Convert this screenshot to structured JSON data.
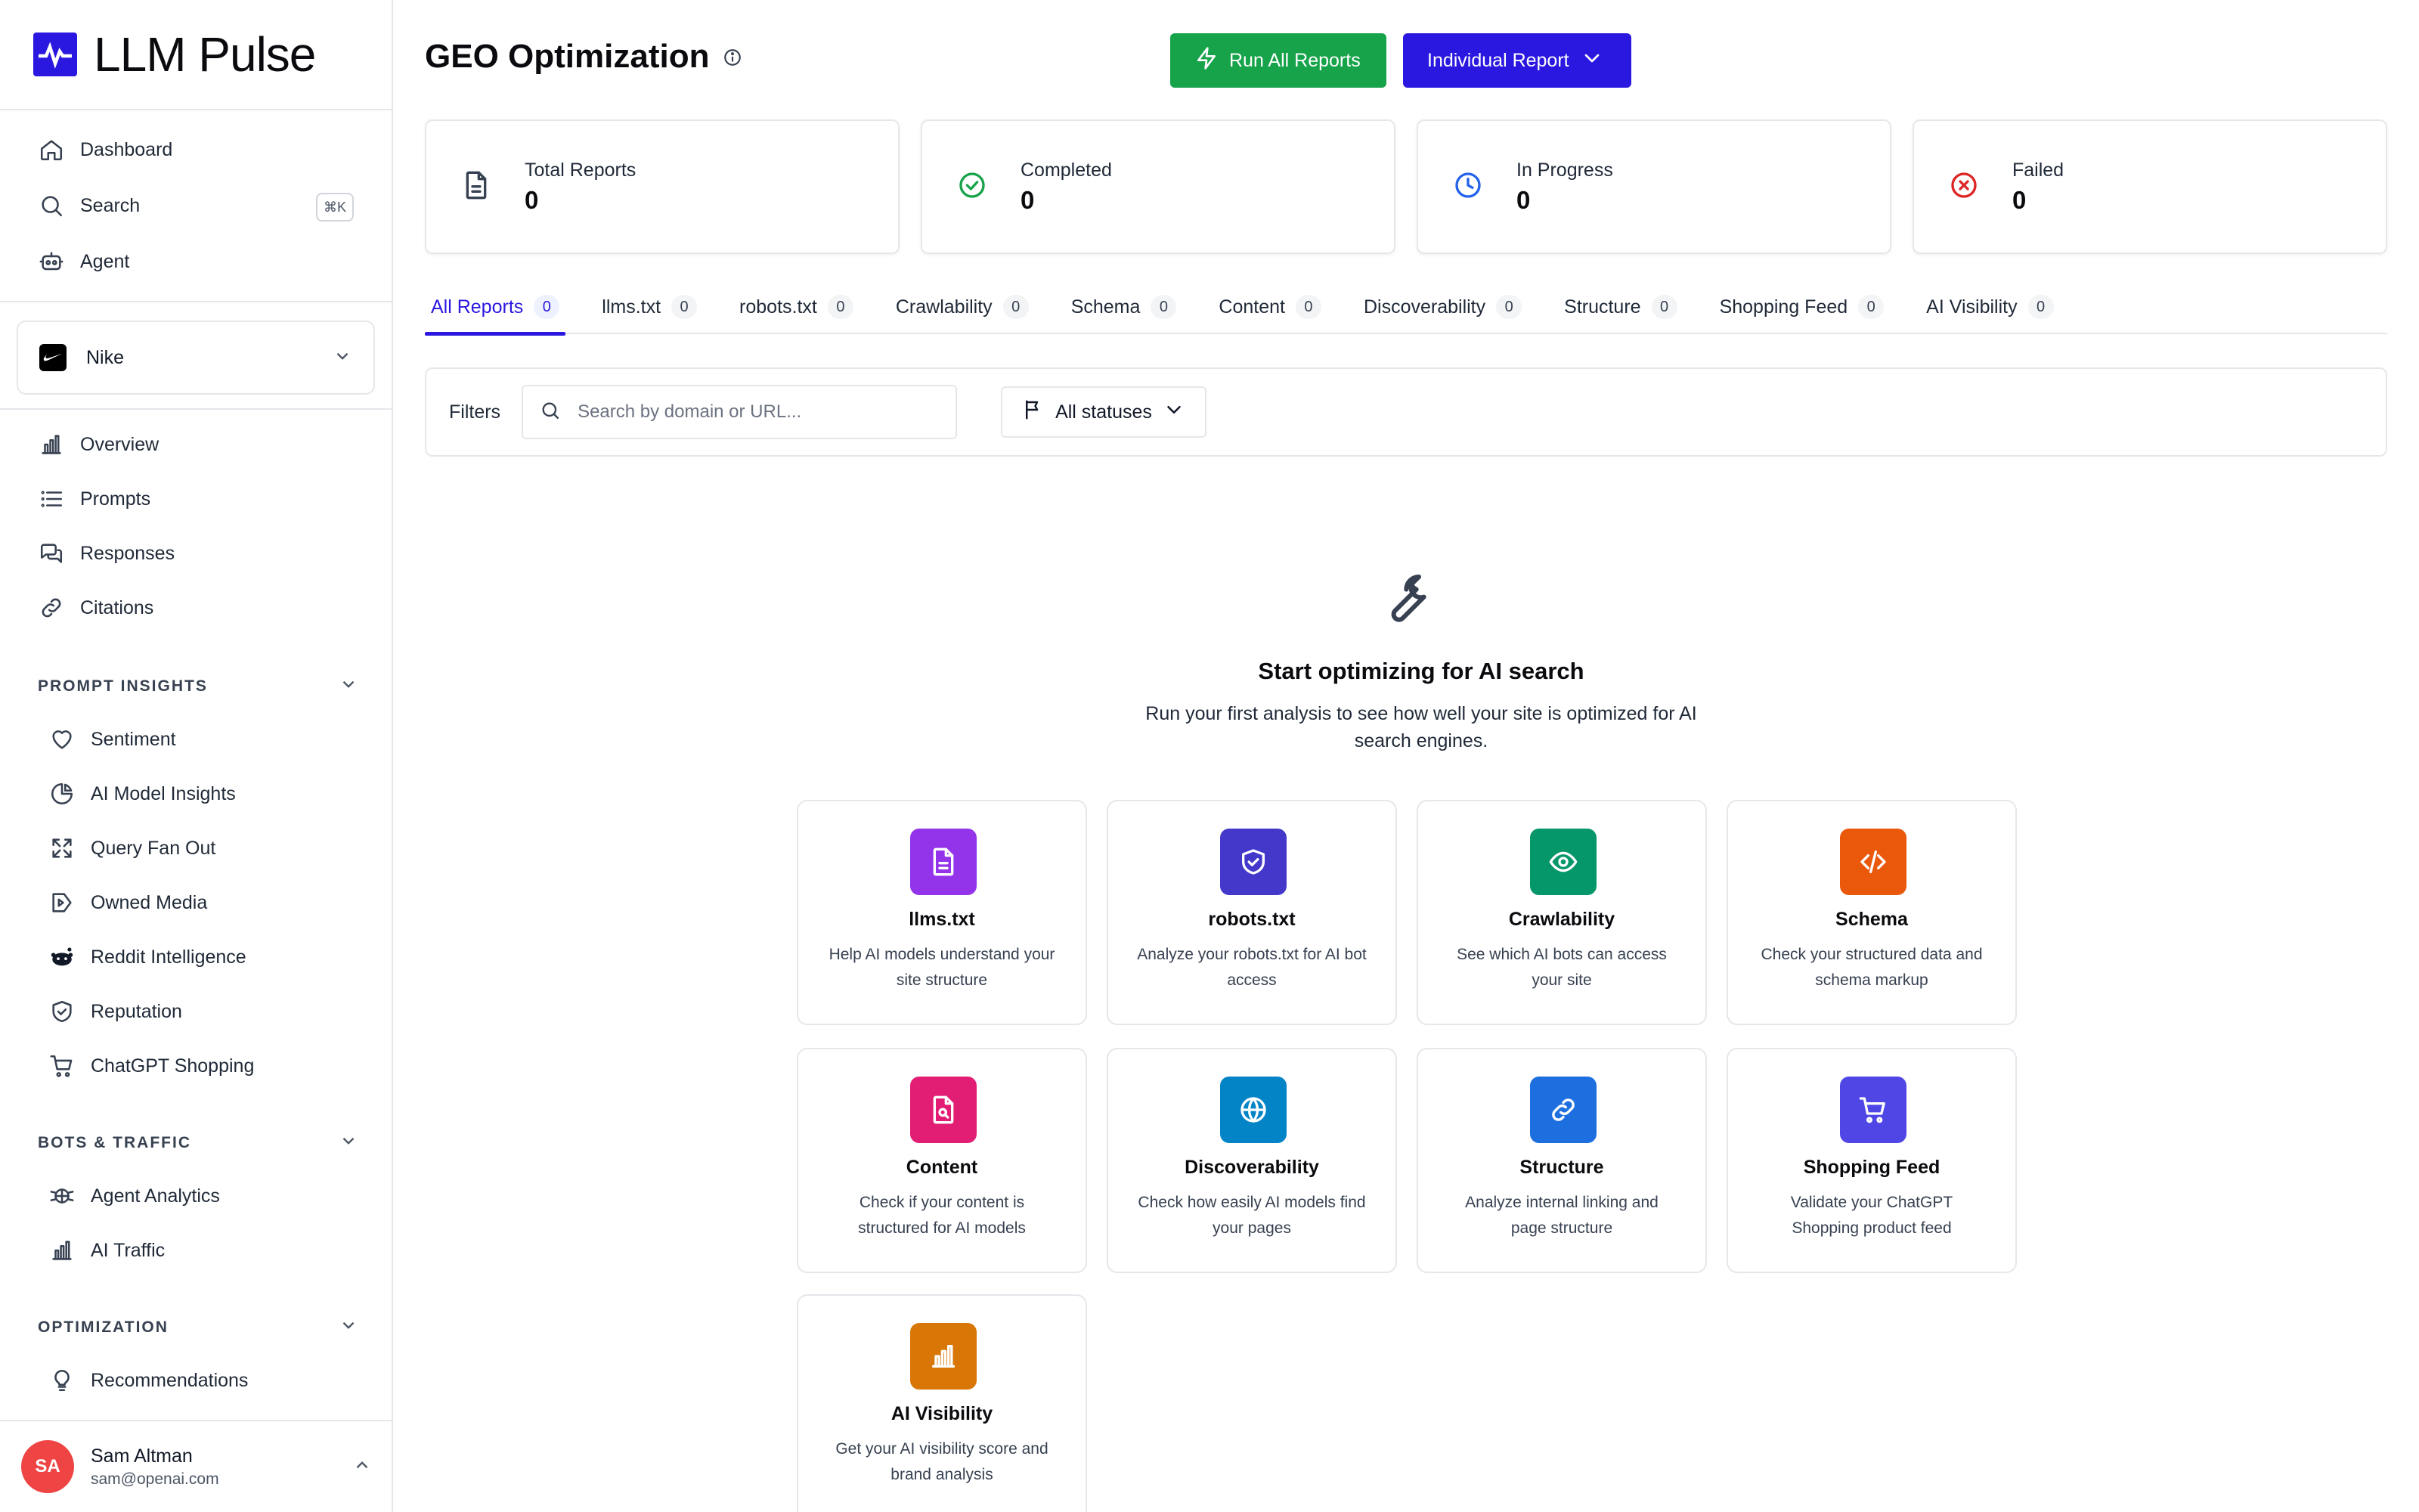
{
  "app": {
    "name": "LLM Pulse"
  },
  "nav": {
    "dashboard": "Dashboard",
    "search": "Search",
    "search_shortcut": "⌘K",
    "agent": "Agent"
  },
  "brand": {
    "name": "Nike"
  },
  "project_nav": {
    "overview": "Overview",
    "prompts": "Prompts",
    "responses": "Responses",
    "citations": "Citations"
  },
  "sections": {
    "prompt_insights": {
      "title": "PROMPT INSIGHTS",
      "items": [
        "Sentiment",
        "AI Model Insights",
        "Query Fan Out",
        "Owned Media",
        "Reddit Intelligence",
        "Reputation",
        "ChatGPT Shopping"
      ]
    },
    "bots_traffic": {
      "title": "BOTS & TRAFFIC",
      "items": [
        "Agent Analytics",
        "AI Traffic"
      ]
    },
    "optimization": {
      "title": "OPTIMIZATION",
      "items": [
        "Recommendations"
      ]
    }
  },
  "user": {
    "initials": "SA",
    "name": "Sam Altman",
    "email": "sam@openai.com"
  },
  "page": {
    "title": "GEO Optimization"
  },
  "actions": {
    "run_all": "Run All Reports",
    "individual": "Individual Report"
  },
  "stats": [
    {
      "label": "Total Reports",
      "value": "0",
      "color": "#374151"
    },
    {
      "label": "Completed",
      "value": "0",
      "color": "#16a34a"
    },
    {
      "label": "In Progress",
      "value": "0",
      "color": "#2563eb"
    },
    {
      "label": "Failed",
      "value": "0",
      "color": "#dc2626"
    }
  ],
  "tabs": [
    {
      "label": "All Reports",
      "count": "0"
    },
    {
      "label": "llms.txt",
      "count": "0"
    },
    {
      "label": "robots.txt",
      "count": "0"
    },
    {
      "label": "Crawlability",
      "count": "0"
    },
    {
      "label": "Schema",
      "count": "0"
    },
    {
      "label": "Content",
      "count": "0"
    },
    {
      "label": "Discoverability",
      "count": "0"
    },
    {
      "label": "Structure",
      "count": "0"
    },
    {
      "label": "Shopping Feed",
      "count": "0"
    },
    {
      "label": "AI Visibility",
      "count": "0"
    }
  ],
  "filters": {
    "label": "Filters",
    "search_placeholder": "Search by domain or URL...",
    "search_value": "",
    "status": "All statuses"
  },
  "empty_state": {
    "title": "Start optimizing for AI search",
    "subtitle": "Run your first analysis to see how well your site is optimized for AI search engines."
  },
  "report_types": [
    {
      "title": "llms.txt",
      "desc": "Help AI models understand your site structure",
      "color": "#9333ea",
      "icon": "file-text-icon"
    },
    {
      "title": "robots.txt",
      "desc": "Analyze your robots.txt for AI bot access",
      "color": "#4338ca",
      "icon": "shield-icon"
    },
    {
      "title": "Crawlability",
      "desc": "See which AI bots can access your site",
      "color": "#059669",
      "icon": "eye-icon"
    },
    {
      "title": "Schema",
      "desc": "Check your structured data and schema markup",
      "color": "#ea580c",
      "icon": "code-icon"
    },
    {
      "title": "Content",
      "desc": "Check if your content is structured for AI models",
      "color": "#e11d74",
      "icon": "file-search-icon"
    },
    {
      "title": "Discoverability",
      "desc": "Check how easily AI models find your pages",
      "color": "#0284c7",
      "icon": "globe-icon"
    },
    {
      "title": "Structure",
      "desc": "Analyze internal linking and page structure",
      "color": "#1d6fe0",
      "icon": "link-icon"
    },
    {
      "title": "Shopping Feed",
      "desc": "Validate your ChatGPT Shopping product feed",
      "color": "#4f46e5",
      "icon": "cart-icon"
    },
    {
      "title": "AI Visibility",
      "desc": "Get your AI visibility score and brand analysis",
      "color": "#d97706",
      "icon": "bar-chart-icon"
    }
  ]
}
